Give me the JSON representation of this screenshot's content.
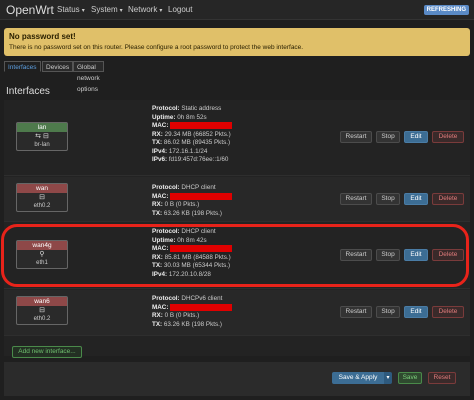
{
  "header": {
    "brand": "OpenWrt",
    "menu": [
      {
        "label": "Status"
      },
      {
        "label": "System"
      },
      {
        "label": "Network"
      },
      {
        "label": "Logout"
      }
    ],
    "status_badge": "REFRESHING"
  },
  "warning": {
    "title": "No password set!",
    "text": "There is no password set on this router. Please configure a root password to protect the web interface."
  },
  "tabs": [
    {
      "label": "Interfaces",
      "active": true
    },
    {
      "label": "Devices",
      "active": false
    },
    {
      "label": "Global network options",
      "active": false
    }
  ],
  "section_title": "Interfaces",
  "buttons": {
    "restart": "Restart",
    "stop": "Stop",
    "edit": "Edit",
    "delete": "Delete"
  },
  "interfaces": [
    {
      "name": "lan",
      "badge_color": "green",
      "icons": "⇆ ⊟",
      "device": "br-lan",
      "lines": [
        {
          "k": "Protocol:",
          "v": "Static address"
        },
        {
          "k": "Uptime:",
          "v": "0h 8m 52s"
        },
        {
          "k": "MAC:",
          "v": "",
          "redacted": true
        },
        {
          "k": "RX:",
          "v": "29.34 MB (66852 Pkts.)"
        },
        {
          "k": "TX:",
          "v": "86.02 MB (89435 Pkts.)"
        },
        {
          "k": "IPv4:",
          "v": "172.16.1.1/24"
        },
        {
          "k": "IPv6:",
          "v": "fd19:457d:76ee::1/60"
        }
      ]
    },
    {
      "name": "wan",
      "badge_color": "red",
      "icons": "⊟",
      "device": "eth0.2",
      "lines": [
        {
          "k": "Protocol:",
          "v": "DHCP client"
        },
        {
          "k": "MAC:",
          "v": "",
          "redacted": true
        },
        {
          "k": "RX:",
          "v": "0 B (0 Pkts.)"
        },
        {
          "k": "TX:",
          "v": "63.26 KB (198 Pkts.)"
        }
      ]
    },
    {
      "name": "wan4g",
      "badge_color": "red",
      "icons": "⚲",
      "device": "eth1",
      "lines": [
        {
          "k": "Protocol:",
          "v": "DHCP client"
        },
        {
          "k": "Uptime:",
          "v": "0h 8m 42s"
        },
        {
          "k": "MAC:",
          "v": "",
          "redacted": true
        },
        {
          "k": "RX:",
          "v": "85.81 MB (84588 Pkts.)"
        },
        {
          "k": "TX:",
          "v": "30.03 MB (65344 Pkts.)"
        },
        {
          "k": "IPv4:",
          "v": "172.20.10.8/28"
        }
      ]
    },
    {
      "name": "wan6",
      "badge_color": "red",
      "icons": "⊟",
      "device": "eth0.2",
      "lines": [
        {
          "k": "Protocol:",
          "v": "DHCPv6 client"
        },
        {
          "k": "MAC:",
          "v": "",
          "redacted": true
        },
        {
          "k": "RX:",
          "v": "0 B (0 Pkts.)"
        },
        {
          "k": "TX:",
          "v": "63.26 KB (198 Pkts.)"
        }
      ]
    }
  ],
  "add_interface": "Add new interface...",
  "footer": {
    "save_apply": "Save & Apply",
    "caret": "▾",
    "save": "Save",
    "reset": "Reset"
  },
  "colors": {
    "accent_blue": "#3c6d94",
    "warning": "#e0c069",
    "highlight_red": "#e8231a",
    "redaction": "#e00000"
  }
}
